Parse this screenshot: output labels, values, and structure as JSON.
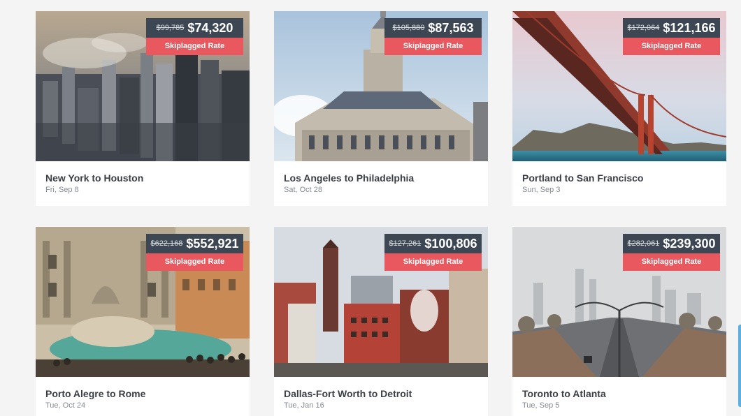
{
  "deals": [
    {
      "route": "New York to Houston",
      "date": "Fri, Sep 8",
      "old_price": "$99,785",
      "price": "$74,320",
      "tag": "Skiplagged Rate"
    },
    {
      "route": "Los Angeles to Philadelphia",
      "date": "Sat, Oct 28",
      "old_price": "$105,880",
      "price": "$87,563",
      "tag": "Skiplagged Rate"
    },
    {
      "route": "Portland to San Francisco",
      "date": "Sun, Sep 3",
      "old_price": "$172,064",
      "price": "$121,166",
      "tag": "Skiplagged Rate"
    },
    {
      "route": "Porto Alegre to Rome",
      "date": "Tue, Oct 24",
      "old_price": "$622,168",
      "price": "$552,921",
      "tag": "Skiplagged Rate"
    },
    {
      "route": "Dallas-Fort Worth to Detroit",
      "date": "Tue, Jan 16",
      "old_price": "$127,261",
      "price": "$100,806",
      "tag": "Skiplagged Rate"
    },
    {
      "route": "Toronto to Atlanta",
      "date": "Tue, Sep 5",
      "old_price": "$282,061",
      "price": "$239,300",
      "tag": "Skiplagged Rate"
    }
  ],
  "colors": {
    "price_bg": "#3d4753",
    "tag_bg": "#e8585e",
    "page_bg": "#f4f4f5",
    "scroll_accent": "#5ab0e0"
  }
}
